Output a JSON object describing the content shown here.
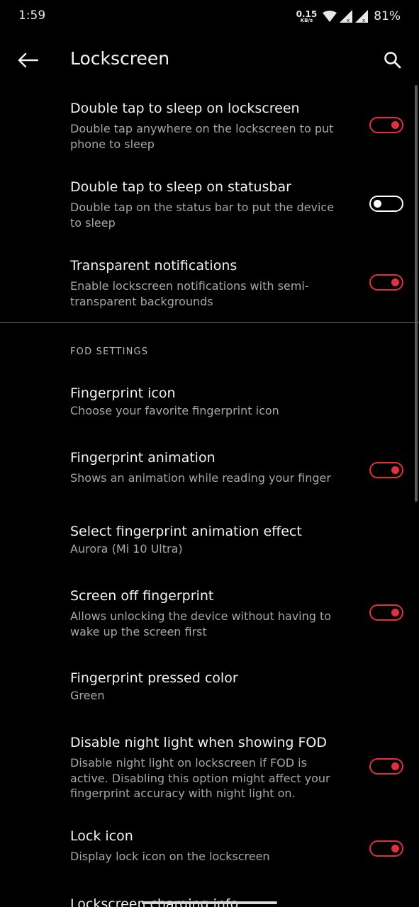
{
  "status_bar": {
    "time": "1:59",
    "net_speed_value": "0.15",
    "net_speed_unit": "KB/s",
    "battery": "81%",
    "icons": [
      "wifi-icon",
      "signal-icon",
      "signal-icon",
      "battery-icon"
    ]
  },
  "app_bar": {
    "title": "Lockscreen",
    "back_icon": "arrow-back-icon",
    "search_icon": "search-icon"
  },
  "accent_color": "#e0303e",
  "preferences_top": [
    {
      "title": "Double tap to sleep on lockscreen",
      "summary": "Double tap anywhere on the lockscreen to put phone to sleep",
      "toggle": true
    },
    {
      "title": "Double tap to sleep on statusbar",
      "summary": "Double tap on the status bar to put the device to sleep",
      "toggle": false
    },
    {
      "title": "Transparent notifications",
      "summary": "Enable lockscreen notifications with semi-transparent backgrounds",
      "toggle": true
    }
  ],
  "fod_section": {
    "header": "FOD SETTINGS",
    "items": [
      {
        "title": "Fingerprint icon",
        "summary": "Choose your favorite fingerprint icon"
      },
      {
        "title": "Fingerprint animation",
        "summary": "Shows an animation while reading your finger",
        "toggle": true
      },
      {
        "title": "Select fingerprint animation effect",
        "summary": "Aurora (Mi 10 Ultra)"
      },
      {
        "title": "Screen off fingerprint",
        "summary": "Allows unlocking the device without having to wake up the screen first",
        "toggle": true
      },
      {
        "title": "Fingerprint pressed color",
        "summary": "Green"
      },
      {
        "title": "Disable night light when showing FOD",
        "summary": "Disable night light on lockscreen if FOD is active. Disabling this option might affect your fingerprint accuracy with night light on.",
        "toggle": true
      },
      {
        "title": "Lock icon",
        "summary": "Display lock icon on the lockscreen",
        "toggle": true
      },
      {
        "title": "Lockscreen charging info"
      }
    ]
  }
}
